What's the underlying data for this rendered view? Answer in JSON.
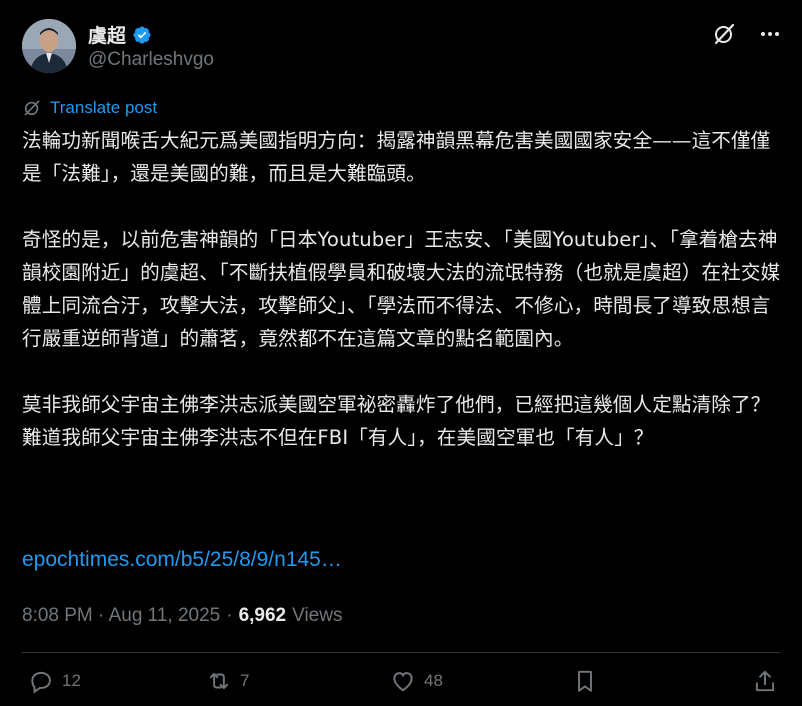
{
  "author": {
    "display_name": "虞超",
    "handle": "@Charleshvgo",
    "verified_icon": "verified-badge-icon",
    "accent": "#1d9bf0"
  },
  "top_icons": [
    "grok-icon",
    "more-options-icon"
  ],
  "translate_label": "Translate post",
  "post_text": "法輪功新聞喉舌大紀元爲美國指明方向：揭露神韻黑幕危害美國國家安全——這不僅僅是「法難」，還是美國的難，而且是大難臨頭。\n\n奇怪的是，以前危害神韻的「日本Youtuber」王志安、「美國Youtuber」、「拿着槍去神韻校園附近」的虞超、「不斷扶植假學員和破壞大法的流氓特務（也就是虞超）在社交媒體上同流合汙，攻擊大法，攻擊師父」、「學法而不得法、不修心，時間長了導致思想言行嚴重逆師背道」的蕭茗，竟然都不在這篇文章的點名範圍內。\n\n莫非我師父宇宙主佛李洪志派美國空軍祕密轟炸了他們，已經把這幾個人定點清除了？難道我師父宇宙主佛李洪志不但在FBI「有人」，在美國空軍也「有人」？",
  "link_text": "epochtimes.com/b5/25/8/9/n145…",
  "timestamp": "8:08 PM · Aug 11, 2025",
  "separator": "·",
  "views_count": "6,962",
  "views_label": "Views",
  "actions": {
    "replies": "12",
    "reposts": "7",
    "likes": "48"
  }
}
